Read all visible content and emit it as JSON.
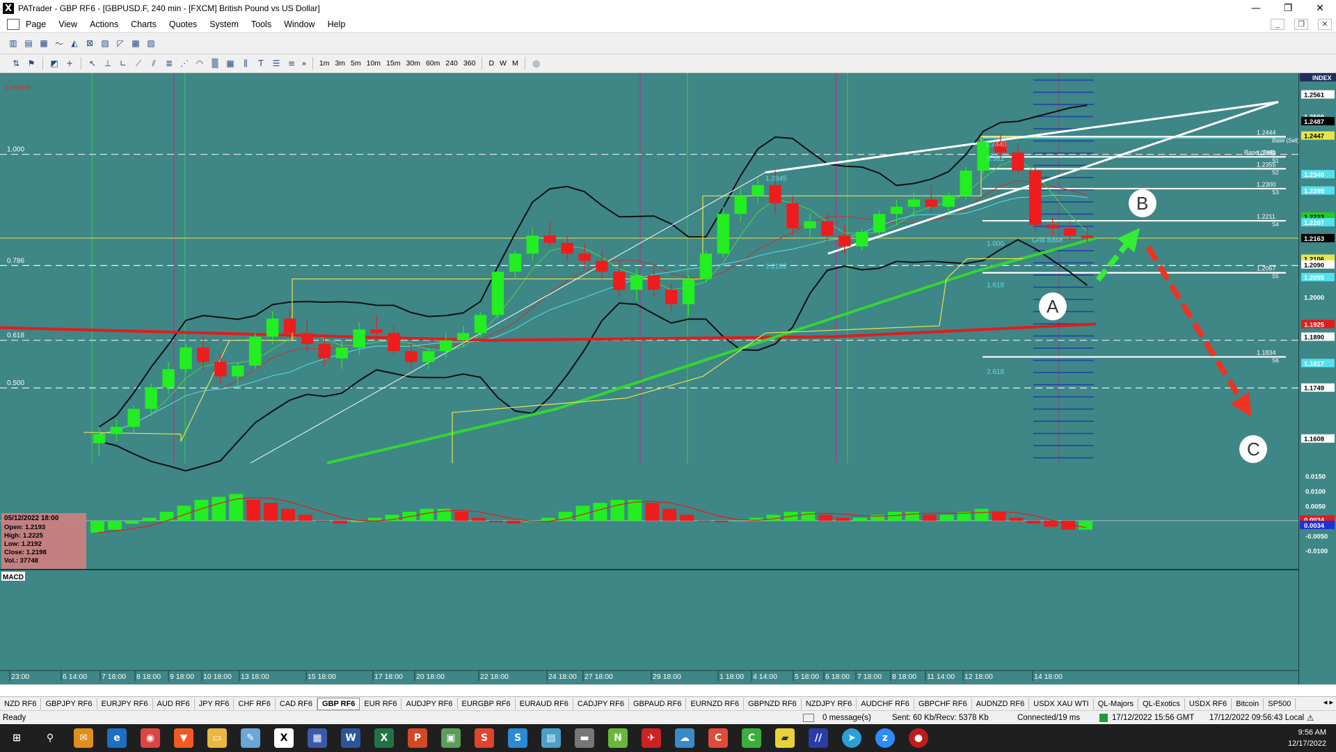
{
  "window": {
    "title": "PATrader - GBP RF6 - [GBPUSD.F, 240 min - [FXCM] British Pound vs US Dollar]",
    "app_icon": "X",
    "minimize": "—",
    "maximize": "❐",
    "close": "✕"
  },
  "menu": {
    "items": [
      "Page",
      "View",
      "Actions",
      "Charts",
      "Quotes",
      "System",
      "Tools",
      "Window",
      "Help"
    ],
    "mdi_min": "_",
    "mdi_restore": "❐",
    "mdi_close": "✕"
  },
  "toolbar2": {
    "timeframes": [
      "1m",
      "3m",
      "5m",
      "10m",
      "15m",
      "30m",
      "60m",
      "240",
      "360",
      "D",
      "W",
      "M"
    ],
    "more": "»"
  },
  "chart": {
    "locked_label": "Locked",
    "macd_label": "MACD",
    "index_label": "INDEX",
    "left_fib_labels": [
      {
        "text": "1.000",
        "y": 1.2395
      },
      {
        "text": "0.786",
        "y": 1.2087
      },
      {
        "text": "0.618",
        "y": 1.188
      },
      {
        "text": "0.500",
        "y": 1.1748
      }
    ],
    "grid_base_label": "Grid Base",
    "base_sell_label": "Base (Sell)",
    "inline_labels": [
      {
        "text": "1.2440",
        "y": 1.244
      },
      {
        "text": "1.2345",
        "y": 1.2345
      },
      {
        "text": "1.2102",
        "y": 1.2102
      },
      {
        "text": "1.000",
        "y": 1.2165
      },
      {
        "text": "1.618",
        "y": 1.205
      },
      {
        "text": "2.618",
        "y": 1.181
      },
      {
        "text": "0.382",
        "y": 1.24
      }
    ],
    "level_lines": [
      {
        "price": "1.2444",
        "tag": "Base (Sell)",
        "y": 1.2444
      },
      {
        "price": "1.2388",
        "tag": "S1",
        "y": 1.2388
      },
      {
        "price": "1.2355",
        "tag": "S2",
        "y": 1.2355
      },
      {
        "price": "1.2300",
        "tag": "S3",
        "y": 1.23
      },
      {
        "price": "1.2211",
        "tag": "S4",
        "y": 1.2211
      },
      {
        "price": "1.2067",
        "tag": "S5",
        "y": 1.2067
      },
      {
        "price": "1.1834",
        "tag": "S6",
        "y": 1.1834
      }
    ],
    "price_axis": [
      {
        "text": "1.2561",
        "y": 1.2561,
        "style": "white"
      },
      {
        "text": "1.2500",
        "y": 1.25,
        "style": "plain"
      },
      {
        "text": "1.2487",
        "y": 1.2487,
        "style": "black"
      },
      {
        "text": "1.2447",
        "y": 1.2447,
        "style": "yellow"
      },
      {
        "text": "1.2340",
        "y": 1.234,
        "style": "cyan"
      },
      {
        "text": "1.2295",
        "y": 1.2295,
        "style": "cyan"
      },
      {
        "text": "1.2223",
        "y": 1.2223,
        "style": "green"
      },
      {
        "text": "1.2207",
        "y": 1.2207,
        "style": "cyan"
      },
      {
        "text": "1.2163",
        "y": 1.2163,
        "style": "black"
      },
      {
        "text": "1.2106",
        "y": 1.2106,
        "style": "yellow"
      },
      {
        "text": "1.2090",
        "y": 1.209,
        "style": "white"
      },
      {
        "text": "1.2055",
        "y": 1.2055,
        "style": "cyan"
      },
      {
        "text": "1.2000",
        "y": 1.2,
        "style": "plain"
      },
      {
        "text": "1.1925",
        "y": 1.1925,
        "style": "red"
      },
      {
        "text": "1.1890",
        "y": 1.189,
        "style": "white"
      },
      {
        "text": "1.1817",
        "y": 1.1817,
        "style": "cyan"
      },
      {
        "text": "1.1749",
        "y": 1.1749,
        "style": "white"
      },
      {
        "text": "1.1608",
        "y": 1.1608,
        "style": "white"
      }
    ],
    "macd_axis": [
      {
        "text": "0.0150",
        "y": 0.015
      },
      {
        "text": "0.0100",
        "y": 0.01
      },
      {
        "text": "0.0050",
        "y": 0.005
      },
      {
        "text": "0.0000",
        "y": 0.0
      },
      {
        "text": "-0.0050",
        "y": -0.005
      },
      {
        "text": "-0.0100",
        "y": -0.01
      }
    ],
    "macd_value_tags": [
      "0.0034",
      "0.0034"
    ],
    "time_labels": [
      "23:00",
      "6 14:00",
      "7 18:00",
      "8 18:00",
      "9 18:00",
      "10 18:00",
      "13 18:00",
      "15 18:00",
      "17 18:00",
      "20 18:00",
      "22 18:00",
      "24 18:00",
      "27 18:00",
      "29 18:00",
      "1 18:00",
      "4 14:00",
      "5 18:00",
      "6 18:00",
      "7 18:00",
      "8 18:00",
      "11 14:00",
      "12 18:00",
      "14 18:00"
    ],
    "annotations": [
      "A",
      "B",
      "C"
    ],
    "info_box": {
      "date": "05/12/2022 18:00",
      "open": "Open: 1.2193",
      "high": "High: 1.2225",
      "low": "Low: 1.2192",
      "close": "Close: 1.2198",
      "vol": "Vol.: 37748"
    }
  },
  "chart_data": {
    "type": "candlestick",
    "title": "GBPUSD.F, 240 min - [FXCM] British Pound vs US Dollar",
    "y_range": [
      1.154,
      1.262
    ],
    "macd_range": [
      -0.011,
      0.017
    ],
    "ohlc": [
      [
        1.1595,
        1.164,
        1.156,
        1.162
      ],
      [
        1.162,
        1.166,
        1.16,
        1.164
      ],
      [
        1.164,
        1.17,
        1.162,
        1.169
      ],
      [
        1.169,
        1.176,
        1.167,
        1.175
      ],
      [
        1.175,
        1.182,
        1.173,
        1.18
      ],
      [
        1.18,
        1.187,
        1.179,
        1.186
      ],
      [
        1.186,
        1.189,
        1.18,
        1.182
      ],
      [
        1.182,
        1.184,
        1.176,
        1.178
      ],
      [
        1.178,
        1.182,
        1.175,
        1.181
      ],
      [
        1.181,
        1.19,
        1.18,
        1.189
      ],
      [
        1.189,
        1.196,
        1.187,
        1.194
      ],
      [
        1.194,
        1.197,
        1.188,
        1.19
      ],
      [
        1.19,
        1.194,
        1.185,
        1.187
      ],
      [
        1.187,
        1.19,
        1.181,
        1.183
      ],
      [
        1.183,
        1.188,
        1.18,
        1.186
      ],
      [
        1.186,
        1.193,
        1.184,
        1.191
      ],
      [
        1.191,
        1.195,
        1.188,
        1.19
      ],
      [
        1.19,
        1.192,
        1.184,
        1.185
      ],
      [
        1.185,
        1.187,
        1.18,
        1.182
      ],
      [
        1.182,
        1.186,
        1.18,
        1.185
      ],
      [
        1.185,
        1.19,
        1.183,
        1.188
      ],
      [
        1.188,
        1.192,
        1.186,
        1.19
      ],
      [
        1.19,
        1.196,
        1.189,
        1.195
      ],
      [
        1.195,
        1.208,
        1.194,
        1.207
      ],
      [
        1.207,
        1.213,
        1.205,
        1.212
      ],
      [
        1.212,
        1.219,
        1.21,
        1.217
      ],
      [
        1.217,
        1.221,
        1.214,
        1.215
      ],
      [
        1.215,
        1.217,
        1.21,
        1.212
      ],
      [
        1.212,
        1.215,
        1.208,
        1.21
      ],
      [
        1.21,
        1.213,
        1.205,
        1.207
      ],
      [
        1.207,
        1.21,
        1.2,
        1.202
      ],
      [
        1.202,
        1.208,
        1.199,
        1.206
      ],
      [
        1.206,
        1.208,
        1.2,
        1.202
      ],
      [
        1.202,
        1.204,
        1.196,
        1.198
      ],
      [
        1.198,
        1.206,
        1.195,
        1.205
      ],
      [
        1.205,
        1.213,
        1.204,
        1.212
      ],
      [
        1.212,
        1.225,
        1.211,
        1.223
      ],
      [
        1.223,
        1.23,
        1.221,
        1.228
      ],
      [
        1.228,
        1.233,
        1.226,
        1.231
      ],
      [
        1.231,
        1.235,
        1.223,
        1.226
      ],
      [
        1.226,
        1.228,
        1.217,
        1.219
      ],
      [
        1.219,
        1.223,
        1.216,
        1.221
      ],
      [
        1.221,
        1.223,
        1.215,
        1.217
      ],
      [
        1.217,
        1.22,
        1.212,
        1.214
      ],
      [
        1.214,
        1.219,
        1.213,
        1.218
      ],
      [
        1.218,
        1.224,
        1.217,
        1.223
      ],
      [
        1.223,
        1.227,
        1.22,
        1.225
      ],
      [
        1.225,
        1.229,
        1.222,
        1.227
      ],
      [
        1.227,
        1.231,
        1.223,
        1.225
      ],
      [
        1.225,
        1.229,
        1.223,
        1.228
      ],
      [
        1.228,
        1.236,
        1.227,
        1.235
      ],
      [
        1.235,
        1.244,
        1.234,
        1.243
      ],
      [
        1.243,
        1.245,
        1.238,
        1.24
      ],
      [
        1.24,
        1.242,
        1.234,
        1.235
      ],
      [
        1.235,
        1.236,
        1.218,
        1.22
      ],
      [
        1.22,
        1.222,
        1.217,
        1.219
      ],
      [
        1.219,
        1.221,
        1.216,
        1.217
      ],
      [
        1.217,
        1.22,
        1.215,
        1.2163
      ]
    ],
    "macd_hist": [
      -0.004,
      -0.003,
      -0.001,
      0.001,
      0.003,
      0.005,
      0.007,
      0.008,
      0.009,
      0.007,
      0.006,
      0.004,
      0.002,
      0.0,
      -0.001,
      -0.0005,
      0.001,
      0.002,
      0.003,
      0.004,
      0.004,
      0.003,
      0.001,
      -0.0005,
      -0.001,
      -0.0005,
      0.001,
      0.003,
      0.005,
      0.006,
      0.007,
      0.007,
      0.006,
      0.004,
      0.002,
      0.0,
      -0.0005,
      0.0,
      0.001,
      0.002,
      0.003,
      0.003,
      0.002,
      0.001,
      0.001,
      0.002,
      0.003,
      0.003,
      0.002,
      0.002,
      0.003,
      0.004,
      0.003,
      0.001,
      -0.001,
      -0.002,
      -0.003,
      -0.003
    ]
  },
  "symbol_tabs": [
    "NZD RF6",
    "GBPJPY RF6",
    "EURJPY RF6",
    "AUD RF6",
    "JPY RF6",
    "CHF RF6",
    "CAD RF6",
    "GBP RF6",
    "EUR RF6",
    "AUDJPY RF6",
    "EURGBP RF6",
    "EURAUD RF6",
    "CADJPY RF6",
    "GBPAUD RF6",
    "EURNZD RF6",
    "GBPNZD RF6",
    "NZDJPY RF6",
    "AUDCHF RF6",
    "GBPCHF RF6",
    "AUDNZD RF6",
    "USDX XAU WTI",
    "QL-Majors",
    "QL-Exotics",
    "USDX RF6",
    "Bitcoin",
    "SP500"
  ],
  "active_tab": "GBP RF6",
  "tab_nav": "◂ ▸",
  "status": {
    "ready": "Ready",
    "messages": "0 message(s)",
    "traffic": "Sent: 60 Kb/Recv: 5378 Kb",
    "connection": "Connected/19 ms",
    "gmt": "17/12/2022 15:56 GMT",
    "local": "17/12/2022 09:56:43 Local"
  },
  "taskbar": {
    "time": "9:56 AM",
    "date": "12/17/2022"
  },
  "colors": {
    "chart_bg": "#3f8686",
    "bull": "#22ee22",
    "bear": "#ee1c1c",
    "ma_red": "#e21c1c",
    "ma_green": "#33d633",
    "fib_yellow": "#e6e64a",
    "cyan": "#55e0ee"
  }
}
